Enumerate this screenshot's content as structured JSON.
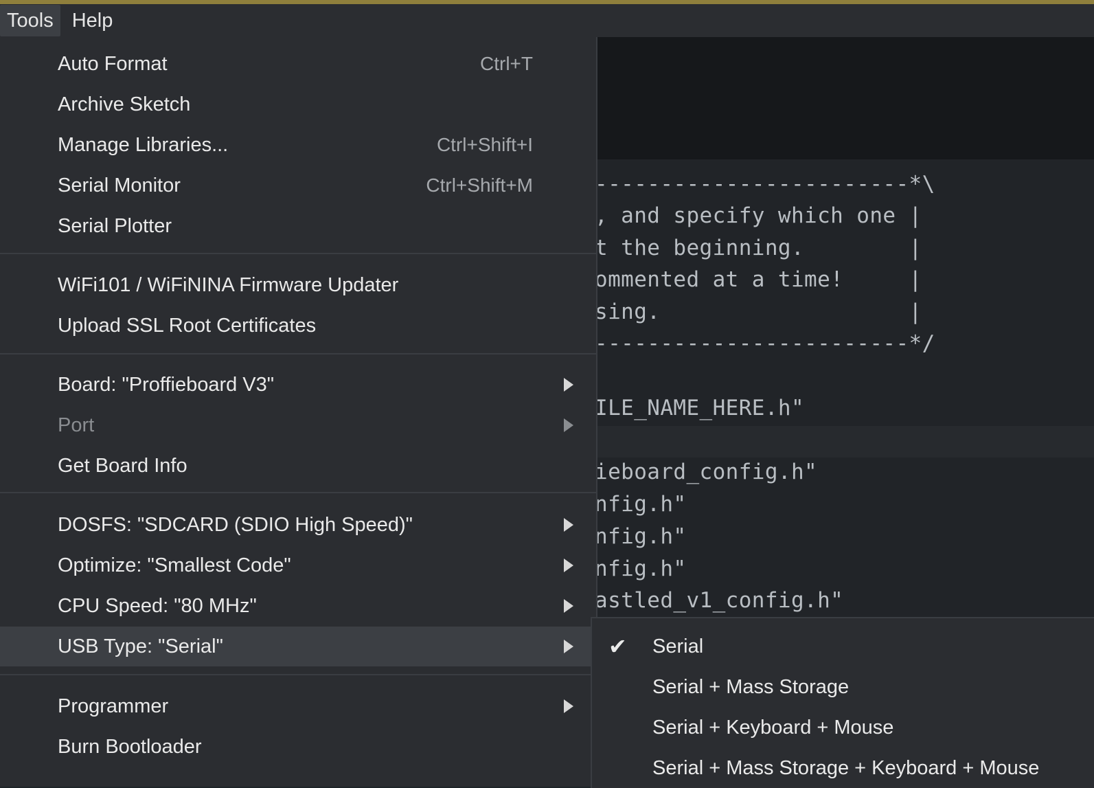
{
  "menubar": {
    "items": [
      {
        "label": "Tools"
      },
      {
        "label": "Help"
      }
    ]
  },
  "tools_menu": {
    "groups": [
      [
        {
          "label": "Auto Format",
          "shortcut": "Ctrl+T"
        },
        {
          "label": "Archive Sketch",
          "shortcut": ""
        },
        {
          "label": "Manage Libraries...",
          "shortcut": "Ctrl+Shift+I"
        },
        {
          "label": "Serial Monitor",
          "shortcut": "Ctrl+Shift+M"
        },
        {
          "label": "Serial Plotter",
          "shortcut": ""
        }
      ],
      [
        {
          "label": "WiFi101 / WiFiNINA Firmware Updater"
        },
        {
          "label": "Upload SSL Root Certificates"
        }
      ],
      [
        {
          "label": "Board: \"Proffieboard V3\"",
          "submenu": true
        },
        {
          "label": "Port",
          "submenu": true,
          "disabled": true
        },
        {
          "label": "Get Board Info"
        }
      ],
      [
        {
          "label": "DOSFS: \"SDCARD (SDIO High Speed)\"",
          "submenu": true
        },
        {
          "label": "Optimize: \"Smallest Code\"",
          "submenu": true
        },
        {
          "label": "CPU Speed: \"80 MHz\"",
          "submenu": true
        },
        {
          "label": "USB Type: \"Serial\"",
          "submenu": true,
          "selected": true
        }
      ],
      [
        {
          "label": "Programmer",
          "submenu": true
        },
        {
          "label": "Burn Bootloader"
        }
      ]
    ]
  },
  "usb_submenu": {
    "items": [
      {
        "label": "Serial",
        "checked": true,
        "check_glyph": "✔"
      },
      {
        "label": "Serial + Mass Storage",
        "checked": false
      },
      {
        "label": "Serial + Keyboard + Mouse",
        "checked": false
      },
      {
        "label": "Serial + Mass Storage + Keyboard + Mouse",
        "checked": false
      }
    ]
  },
  "editor": {
    "lines": [
      "------------------------*\\",
      ", and specify which one |",
      "t the beginning.        |",
      "ommented at a time!     |",
      "sing.                   |",
      "------------------------*/",
      "ILE_NAME_HERE.h\"",
      "ieboard_config.h\"",
      "nfig.h\"",
      "nfig.h\"",
      "nfig.h\"",
      "astled_v1_config.h\""
    ]
  },
  "colors": {
    "menu_bg": "#2b2d31",
    "selected_bg": "#3c3f44",
    "accent_top": "#8f7f3c",
    "editor_bg": "#212428"
  }
}
